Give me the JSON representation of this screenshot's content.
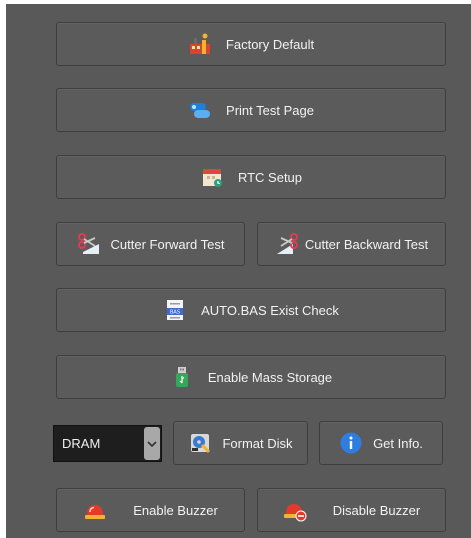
{
  "buttons": {
    "factory_default": "Factory Default",
    "print_test_page": "Print Test Page",
    "rtc_setup": "RTC Setup",
    "cutter_forward_test": "Cutter Forward Test",
    "cutter_backward_test": "Cutter Backward Test",
    "autobas_exist_check": "AUTO.BAS Exist Check",
    "enable_mass_storage": "Enable Mass Storage",
    "format_disk": "Format Disk",
    "get_info": "Get Info.",
    "enable_buzzer": "Enable Buzzer",
    "disable_buzzer": "Disable Buzzer"
  },
  "memory_select": {
    "selected": "DRAM"
  },
  "icons": {
    "factory_default": "factory-icon",
    "print_test_page": "printer-icon",
    "rtc_setup": "calendar-clock-icon",
    "cutter_forward_test": "scissors-icon",
    "cutter_backward_test": "scissors-icon",
    "autobas_exist_check": "bas-file-icon",
    "enable_mass_storage": "usb-drive-icon",
    "format_disk": "format-disk-icon",
    "get_info": "info-icon",
    "enable_buzzer": "alarm-icon",
    "disable_buzzer": "alarm-off-icon"
  }
}
